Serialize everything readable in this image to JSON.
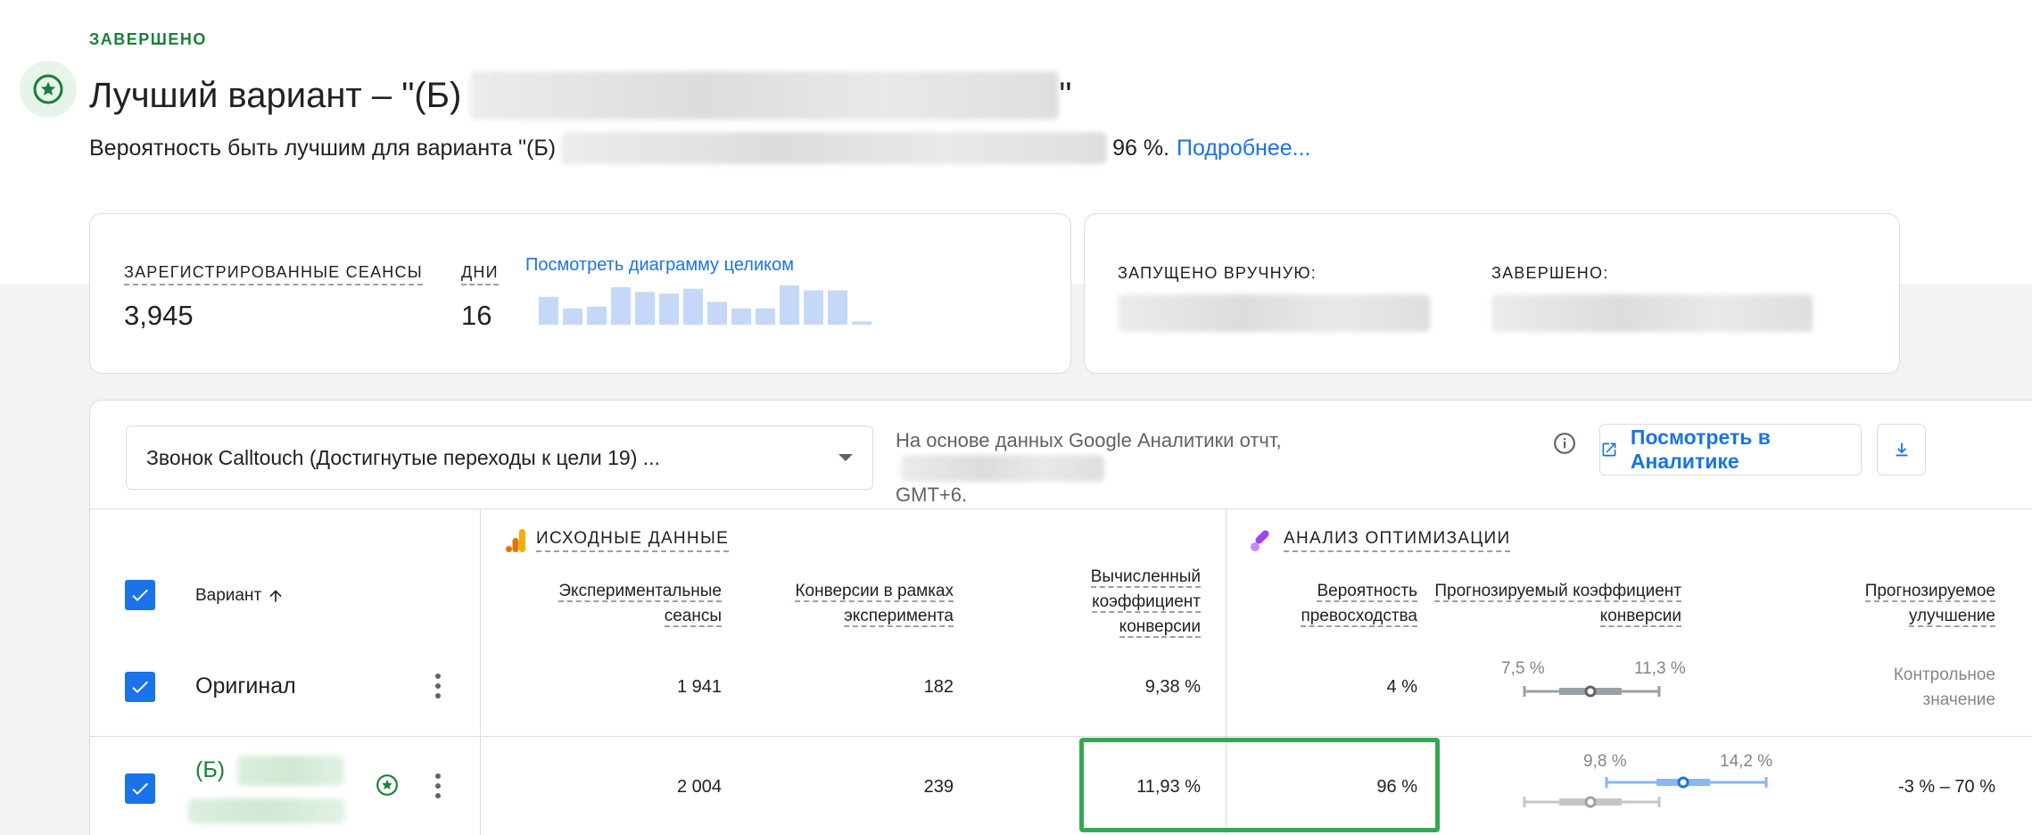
{
  "header": {
    "status": "ЗАВЕРШЕНО",
    "winner_title_prefix": "Лучший вариант – \"(Б)",
    "winner_title_suffix": "\"",
    "probability_prefix": "Вероятность быть лучшим для варианта \"(Б)",
    "probability_value": "96 %.",
    "more_link": "Подробнее..."
  },
  "summary_card": {
    "sessions_label": "ЗАРЕГИСТРИРОВАННЫЕ СЕАНСЫ",
    "sessions_value": "3,945",
    "days_label": "ДНИ",
    "days_value": "16",
    "view_chart_link": "Посмотреть диаграмму целиком",
    "sparkline_values": [
      17,
      10,
      11,
      23,
      20,
      19,
      22,
      14,
      10,
      10,
      24,
      21,
      21,
      2
    ]
  },
  "dates_card": {
    "started_label": "ЗАПУЩЕНО ВРУЧНУЮ:",
    "ended_label": "ЗАВЕРШЕНО:"
  },
  "toolbar": {
    "goal_select_value": "Звонок Calltouch (Достигнутые переходы к цели 19) ...",
    "based_on_prefix": "На основе данных Google Аналитики отчт,",
    "based_on_suffix": "GMT+6.",
    "view_in_analytics": "Посмотреть в Аналитике"
  },
  "table": {
    "variant_header": "Вариант",
    "section_source": "ИСХОДНЫЕ ДАННЫЕ",
    "section_optimize": "АНАЛИЗ ОПТИМИЗАЦИИ",
    "col_sessions": [
      "Экспериментальные",
      "сеансы"
    ],
    "col_conversions": [
      "Конверсии в рамках",
      "эксперимента"
    ],
    "col_rate": [
      "Вычисленный",
      "коэффициент",
      "конверсии"
    ],
    "col_probability": [
      "Вероятность",
      "превосходства"
    ],
    "col_predicted_rate": [
      "Прогнозируемый коэффициент",
      "конверсии"
    ],
    "col_improvement": [
      "Прогнозируемое",
      "улучшение"
    ],
    "rows": [
      {
        "name": "Оригинал",
        "sessions": "1 941",
        "conversions": "182",
        "rate": "9,38 %",
        "probability": "4 %",
        "ci_low": "7,5 %",
        "ci_high": "11,3 %",
        "improvement_line1": "Контрольное",
        "improvement_line2": "значение"
      },
      {
        "name": "(Б)",
        "sessions": "2 004",
        "conversions": "239",
        "rate": "11,93 %",
        "probability": "96 %",
        "ci_low": "9,8 %",
        "ci_high": "14,2 %",
        "improvement": "-3 % – 70 %"
      }
    ]
  },
  "colors": {
    "accent_blue": "#1a73e8",
    "winner_green": "#188038",
    "highlight_green": "#34a853",
    "sparkline": "#c5d8f7"
  }
}
